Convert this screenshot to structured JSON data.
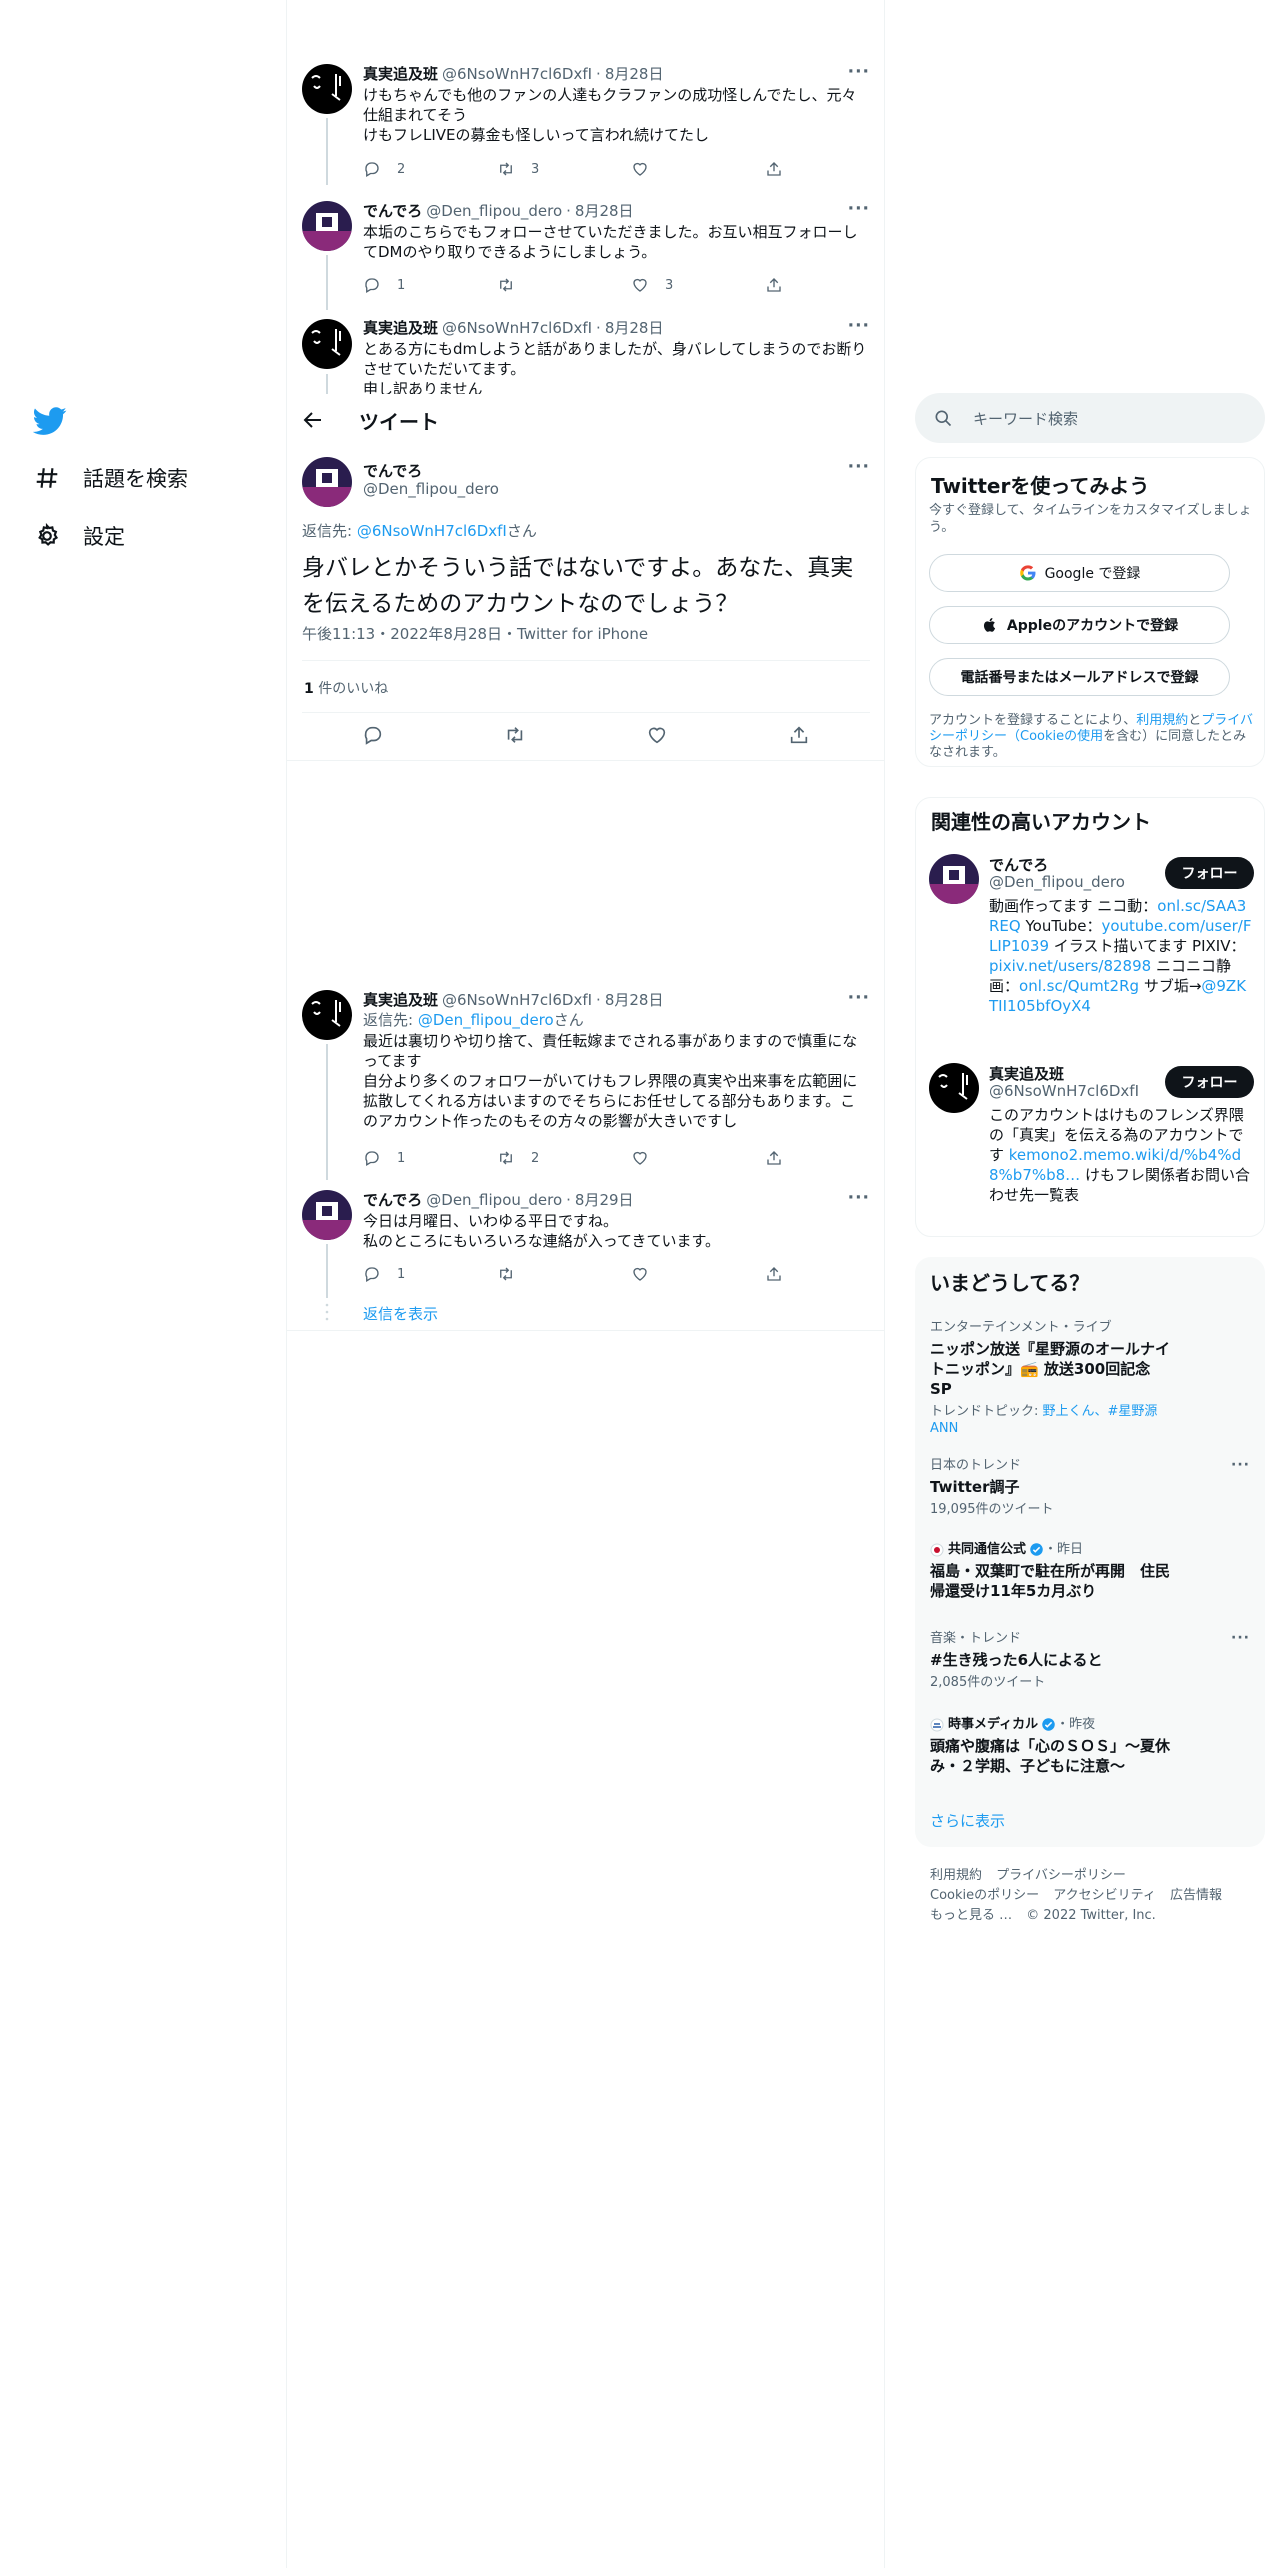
{
  "nav": {
    "items": [
      {
        "label": "話題を検索",
        "icon": "hashtag-icon"
      },
      {
        "label": "設定",
        "icon": "gear-icon"
      }
    ]
  },
  "header": {
    "title": "ツイート"
  },
  "thread_top": [
    {
      "name": "真実追及班",
      "handle": "@6NsoWnH7cl6DxfI",
      "date": "8月28日",
      "text": "けもちゃんでも他のファンの人達もクラファンの成功怪しんでたし、元々仕組まれてそう\nけもフレLIVEの募金も怪しいって言われ続けてたし",
      "replies": "2",
      "retweets": "3",
      "likes": ""
    },
    {
      "name": "でんでろ",
      "handle": "@Den_flipou_dero",
      "date": "8月28日",
      "text": "本垢のこちらでもフォローさせていただきました。お互い相互フォローしてDMのやり取りできるようにしましょう。",
      "replies": "1",
      "retweets": "",
      "likes": "3"
    },
    {
      "name": "真実追及班",
      "handle": "@6NsoWnH7cl6DxfI",
      "date": "8月28日",
      "text": "とある方にもdmしようと話がありましたが、身バレしてしまうのでお断りさせていただいてます。\n申し訳ありません"
    }
  ],
  "focus": {
    "name": "でんでろ",
    "handle": "@Den_flipou_dero",
    "reply_prefix": "返信先: ",
    "reply_handle": "@6NsoWnH7cl6DxfI",
    "reply_suffix": "さん",
    "text": "身バレとかそういう話ではないですよ。あなた、真実を伝えるためのアカウントなのでしょう？",
    "meta": "午後11:13・2022年8月28日・Twitter for iPhone",
    "likes_count": "1",
    "likes_label": " 件のいいね"
  },
  "replies": [
    {
      "name": "真実追及班",
      "handle": "@6NsoWnH7cl6DxfI",
      "date": "8月28日",
      "reply_prefix": "返信先: ",
      "reply_handle": "@Den_flipou_dero",
      "reply_suffix": "さん",
      "text": "最近は裏切りや切り捨て、責任転嫁までされる事がありますので慎重になってます\n自分より多くのフォロワーがいてけもフレ界隈の真実や出来事を広範囲に拡散してくれる方はいますのでそちらにお任せしてる部分もあります。このアカウント作ったのもその方々の影響が大きいですし",
      "replies": "1",
      "retweets": "2",
      "likes": ""
    },
    {
      "name": "でんでろ",
      "handle": "@Den_flipou_dero",
      "date": "8月29日",
      "text": "今日は月曜日、いわゆる平日ですね。\n私のところにもいろいろな連絡が入ってきています。",
      "replies": "1",
      "retweets": "",
      "likes": ""
    }
  ],
  "show_replies": "返信を表示",
  "search": {
    "placeholder": "キーワード検索"
  },
  "signup": {
    "title": "Twitterを使ってみよう",
    "subtitle": "今すぐ登録して、タイムラインをカスタマイズしましょう。",
    "google": "Google で登録",
    "apple": "Appleのアカウントで登録",
    "phone": "電話番号またはメールアドレスで登録",
    "terms_prefix": "アカウントを登録することにより、",
    "terms_link1": "利用規約",
    "terms_and": "と",
    "terms_link2": "プライバシーポリシー（Cookieの使用",
    "terms_suffix": "を含む）に同意したとみなされます。"
  },
  "related": {
    "title": "関連性の高いアカウント",
    "follow_label": "フォロー",
    "accounts": [
      {
        "name": "でんでろ",
        "handle": "@Den_flipou_dero",
        "bio_1": "動画作ってます ニコ動：",
        "bio_link_1": "onl.sc/SAA3REQ",
        "bio_2": " YouTube：",
        "bio_link_2": "youtube.com/user/FLIP1039",
        "bio_3": " イラスト描いてます PIXIV：",
        "bio_link_3": "pixiv.net/users/82898",
        "bio_4": " ニコニコ静画：",
        "bio_link_4": "onl.sc/Qumt2Rg",
        "bio_5": " サブ垢→",
        "bio_link_5": "@9ZKTII105bfOyX4"
      },
      {
        "name": "真実追及班",
        "handle": "@6NsoWnH7cl6DxfI",
        "bio_1": "このアカウントはけものフレンズ界隈の「真実」を伝える為のアカウントです ",
        "bio_link_1": "kemono2.memo.wiki/d/%b4%d8%b7%b8…",
        "bio_2": " けもフレ関係者お問い合わせ先一覧表"
      }
    ]
  },
  "trends": {
    "title": "いまどうしてる？",
    "items": [
      {
        "context": "エンターテインメント・ライブ",
        "title": "ニッポン放送『星野源のオールナイトニッポン』📻 放送300回記念SP",
        "sub_prefix": "トレンドトピック: ",
        "sub_links": "野上くん、#星野源ANN"
      },
      {
        "context": "日本のトレンド",
        "title": "Twitter調子",
        "count": "19,095件のツイート"
      },
      {
        "source": "共同通信公式",
        "time": "・昨日",
        "title": "福島・双葉町で駐在所が再開　住民帰還受け11年5カ月ぶり"
      },
      {
        "context": "音楽・トレンド",
        "title": "#生き残った6人によると",
        "count": "2,085件のツイート"
      },
      {
        "source": "時事メディカル",
        "time": "・昨夜",
        "title": "頭痛や腹痛は「心のＳＯＳ」～夏休み・２学期、子どもに注意～"
      }
    ],
    "show_more": "さらに表示"
  },
  "footer": {
    "links": [
      "利用規約",
      "プライバシーポリシー",
      "Cookieのポリシー",
      "アクセシビリティ",
      "広告情報",
      "もっと見る …"
    ],
    "copyright": "© 2022 Twitter, Inc."
  },
  "colors": {
    "accent": "#1d9bf0",
    "text": "#0f1419",
    "muted": "#536471",
    "border": "#eff3f4"
  }
}
